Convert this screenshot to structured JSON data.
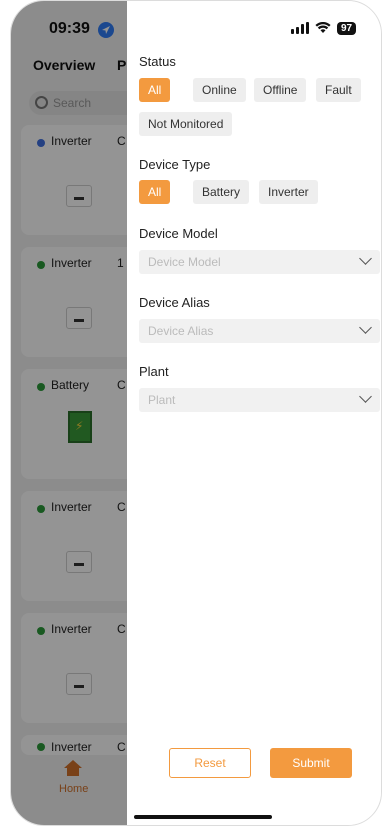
{
  "status_bar": {
    "time": "09:39",
    "battery": "97"
  },
  "background": {
    "tabs": [
      "Overview",
      "P"
    ],
    "search_placeholder": "Search",
    "cards": [
      {
        "title": "Inverter",
        "letter": "C",
        "status_color": "#3f6fe0"
      },
      {
        "title": "Inverter",
        "letter": "1",
        "status_color": "#2b9a3a"
      },
      {
        "title": "Battery",
        "letter": "C",
        "status_color": "#2b9a3a"
      },
      {
        "title": "Inverter",
        "letter": "C",
        "status_color": "#2b9a3a"
      },
      {
        "title": "Inverter",
        "letter": "C",
        "status_color": "#2b9a3a"
      },
      {
        "title": "Inverter",
        "letter": "C",
        "status_color": "#2b9a3a"
      }
    ],
    "home_label": "Home"
  },
  "filter": {
    "status": {
      "title": "Status",
      "options": [
        "All",
        "Online",
        "Offline",
        "Fault",
        "Not Monitored"
      ],
      "selected": "All"
    },
    "device_type": {
      "title": "Device Type",
      "options": [
        "All",
        "Battery",
        "Inverter"
      ],
      "selected": "All"
    },
    "device_model": {
      "title": "Device Model",
      "placeholder": "Device Model"
    },
    "device_alias": {
      "title": "Device Alias",
      "placeholder": "Device Alias"
    },
    "plant": {
      "title": "Plant",
      "placeholder": "Plant"
    },
    "reset_label": "Reset",
    "submit_label": "Submit"
  },
  "colors": {
    "accent": "#f39a3f",
    "chip_bg": "#eeeeee"
  }
}
